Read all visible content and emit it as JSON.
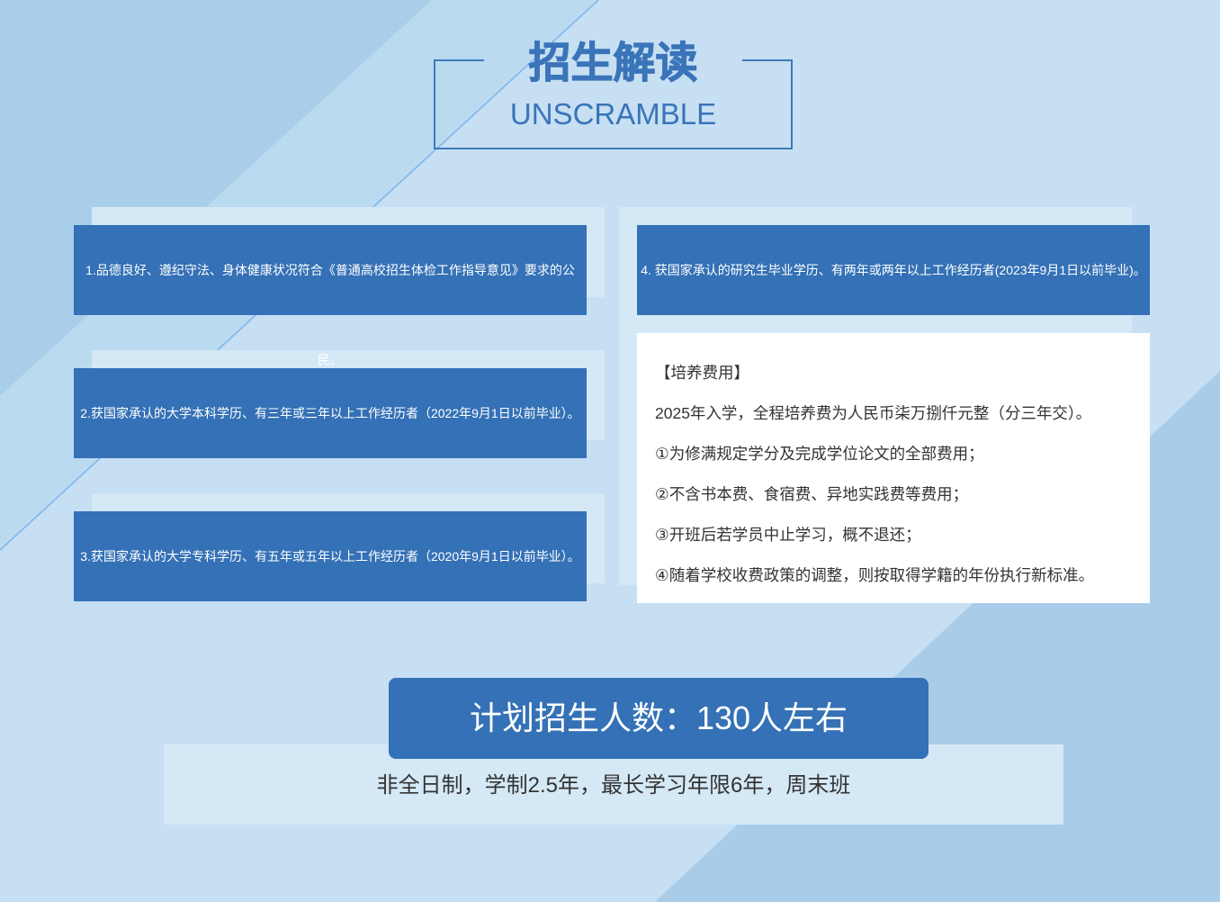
{
  "header": {
    "title": "招生解读",
    "subtitle": "UNSCRAMBLE"
  },
  "requirements": [
    {
      "lines": [
        "1.品德良好、遵纪守法、身体健康状况符合《普通高校招生体检工作指导意见》要求的公",
        "民。"
      ]
    },
    {
      "lines": [
        "2.获国家承认的大学本科学历、有三年或三年以上工作经历者（2022年9月1日以前毕业）。"
      ]
    },
    {
      "lines": [
        "3.获国家承认的大学专科学历、有五年或五年以上工作经历者（2020年9月1日以前毕业）。"
      ]
    },
    {
      "lines": [
        "4. 获国家承认的研究生毕业学历、有两年或两年以上工作经历者(2023年9月1日以前毕业)。"
      ]
    }
  ],
  "fees": {
    "heading": "【培养费用】",
    "lines": [
      "2025年入学，全程培养费为人民币柒万捌仟元整（分三年交）。",
      "①为修满规定学分及完成学位论文的全部费用；",
      "②不含书本费、食宿费、异地实践费等费用；",
      "③开班后若学员中止学习，概不退还；",
      "④随着学校收费政策的调整，则按取得学籍的年份执行新标准。"
    ]
  },
  "enrollment": {
    "plan": "计划招生人数：130人左右",
    "schedule": "非全日制，学制2.5年，最长学习年限6年，周末班"
  },
  "theme": {
    "accent": "#3471b6",
    "title": "#3a74b9",
    "frame": "#3d79ba",
    "panel": "#d5e8f6",
    "text": "#333333",
    "card_text": "#ffffff",
    "fees_bg": "#ffffff"
  }
}
